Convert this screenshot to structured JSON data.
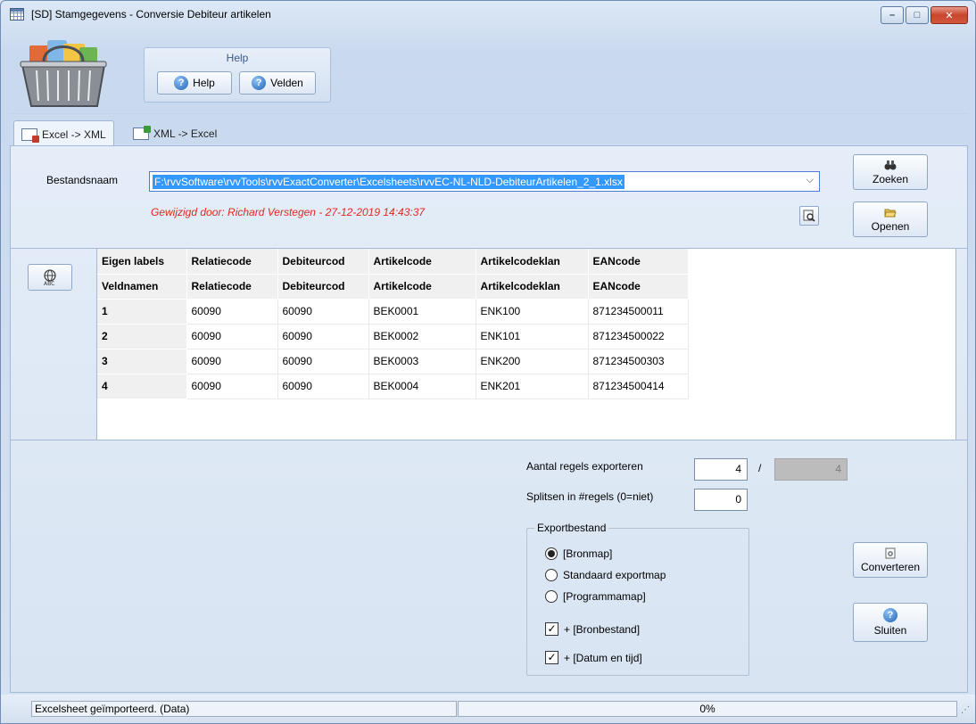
{
  "window": {
    "title": "[SD]  Stamgegevens - Conversie Debiteur artikelen",
    "controls": {
      "minimize": "–",
      "maximize": "□",
      "close": "✕"
    }
  },
  "ribbon": {
    "help_group_title": "Help",
    "help_button": "Help",
    "velden_button": "Velden"
  },
  "tabs": [
    {
      "label": "Excel -> XML",
      "active": true
    },
    {
      "label": "XML -> Excel",
      "active": false
    }
  ],
  "file": {
    "label": "Bestandsnaam",
    "value": "F:\\rvvSoftware\\rvvTools\\rvvExactConverter\\Excelsheets\\rvvEC-NL-NLD-DebiteurArtikelen_2_1.xlsx",
    "modified": "Gewijzigd door: Richard Verstegen   -   27-12-2019  14:43:37"
  },
  "buttons": {
    "zoeken": "Zoeken",
    "openen": "Openen",
    "converteren": "Converteren",
    "sluiten": "Sluiten"
  },
  "grid": {
    "header_rows": [
      [
        "Eigen labels",
        "Relatiecode",
        "Debiteurcod",
        "Artikelcode",
        "Artikelcodeklan",
        "EANcode"
      ],
      [
        "Veldnamen",
        "Relatiecode",
        "Debiteurcod",
        "Artikelcode",
        "Artikelcodeklan",
        "EANcode"
      ]
    ],
    "rows": [
      [
        "1",
        "60090",
        "60090",
        "BEK0001",
        "ENK100",
        "871234500011"
      ],
      [
        "2",
        "60090",
        "60090",
        "BEK0002",
        "ENK101",
        "871234500022"
      ],
      [
        "3",
        "60090",
        "60090",
        "BEK0003",
        "ENK200",
        "871234500303"
      ],
      [
        "4",
        "60090",
        "60090",
        "BEK0004",
        "ENK201",
        "871234500414"
      ]
    ]
  },
  "export": {
    "aantal_label": "Aantal regels exporteren",
    "aantal_value": "4",
    "separator": "/",
    "aantal_total": "4",
    "splitsen_label": "Splitsen in #regels (0=niet)",
    "splitsen_value": "0",
    "bestand_legend": "Exportbestand",
    "options": [
      {
        "label": "[Bronmap]",
        "selected": true
      },
      {
        "label": "Standaard exportmap",
        "selected": false
      },
      {
        "label": "[Programmamap]",
        "selected": false
      }
    ],
    "checks": [
      {
        "label": "+ [Bronbestand]",
        "checked": true
      },
      {
        "label": "+ [Datum en tijd]",
        "checked": true
      }
    ]
  },
  "status": {
    "message": "Excelsheet geïmporteerd. (Data)",
    "progress": "0%"
  }
}
